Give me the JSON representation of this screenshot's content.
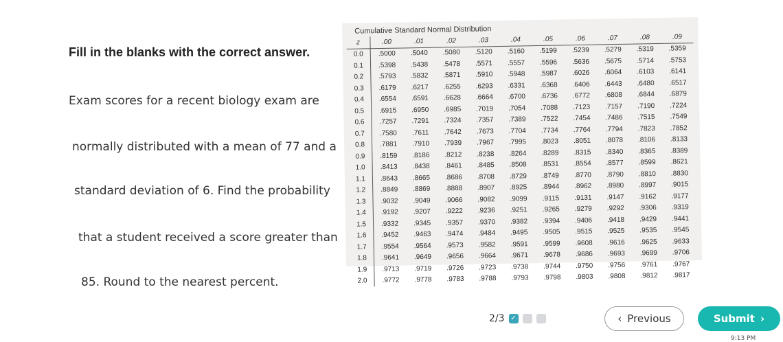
{
  "question": {
    "heading": "Fill in the blanks with the correct answer.",
    "lines": [
      "Exam scores for a recent biology exam are",
      "normally distributed with a mean of 77 and a",
      "standard deviation of 6. Find the probability",
      "that a student received a score greater than",
      "85. Round to the nearest percent."
    ]
  },
  "table": {
    "title": "Cumulative Standard Normal Distribution",
    "z_header": "z",
    "columns": [
      ".00",
      ".01",
      ".02",
      ".03",
      ".04",
      ".05",
      ".06",
      ".07",
      ".08",
      ".09"
    ],
    "rows": [
      {
        "z": "0.0",
        "p": [
          ".5000",
          ".5040",
          ".5080",
          ".5120",
          ".5160",
          ".5199",
          ".5239",
          ".5279",
          ".5319",
          ".5359"
        ]
      },
      {
        "z": "0.1",
        "p": [
          ".5398",
          ".5438",
          ".5478",
          ".5571",
          ".5557",
          ".5596",
          ".5636",
          ".5675",
          ".5714",
          ".5753"
        ]
      },
      {
        "z": "0.2",
        "p": [
          ".5793",
          ".5832",
          ".5871",
          ".5910",
          ".5948",
          ".5987",
          ".6026",
          ".6064",
          ".6103",
          ".6141"
        ]
      },
      {
        "z": "0.3",
        "p": [
          ".6179",
          ".6217",
          ".6255",
          ".6293",
          ".6331",
          ".6368",
          ".6406",
          ".6443",
          ".6480",
          ".6517"
        ]
      },
      {
        "z": "0.4",
        "p": [
          ".6554",
          ".6591",
          ".6628",
          ".6664",
          ".6700",
          ".6736",
          ".6772",
          ".6808",
          ".6844",
          ".6879"
        ]
      },
      {
        "z": "0.5",
        "p": [
          ".6915",
          ".6950",
          ".6985",
          ".7019",
          ".7054",
          ".7088",
          ".7123",
          ".7157",
          ".7190",
          ".7224"
        ]
      },
      {
        "z": "0.6",
        "p": [
          ".7257",
          ".7291",
          ".7324",
          ".7357",
          ".7389",
          ".7522",
          ".7454",
          ".7486",
          ".7515",
          ".7549"
        ]
      },
      {
        "z": "0.7",
        "p": [
          ".7580",
          ".7611",
          ".7642",
          ".7673",
          ".7704",
          ".7734",
          ".7764",
          ".7794",
          ".7823",
          ".7852"
        ]
      },
      {
        "z": "0.8",
        "p": [
          ".7881",
          ".7910",
          ".7939",
          ".7967",
          ".7995",
          ".8023",
          ".8051",
          ".8078",
          ".8106",
          ".8133"
        ]
      },
      {
        "z": "0.9",
        "p": [
          ".8159",
          ".8186",
          ".8212",
          ".8238",
          ".8264",
          ".8289",
          ".8315",
          ".8340",
          ".8365",
          ".8389"
        ]
      },
      {
        "z": "1.0",
        "p": [
          ".8413",
          ".8438",
          ".8461",
          ".8485",
          ".8508",
          ".8531",
          ".8554",
          ".8577",
          ".8599",
          ".8621"
        ]
      },
      {
        "z": "1.1",
        "p": [
          ".8643",
          ".8665",
          ".8686",
          ".8708",
          ".8729",
          ".8749",
          ".8770",
          ".8790",
          ".8810",
          ".8830"
        ]
      },
      {
        "z": "1.2",
        "p": [
          ".8849",
          ".8869",
          ".8888",
          ".8907",
          ".8925",
          ".8944",
          ".8962",
          ".8980",
          ".8997",
          ".9015"
        ]
      },
      {
        "z": "1.3",
        "p": [
          ".9032",
          ".9049",
          ".9066",
          ".9082",
          ".9099",
          ".9115",
          ".9131",
          ".9147",
          ".9162",
          ".9177"
        ]
      },
      {
        "z": "1.4",
        "p": [
          ".9192",
          ".9207",
          ".9222",
          ".9236",
          ".9251",
          ".9265",
          ".9279",
          ".9292",
          ".9306",
          ".9319"
        ]
      },
      {
        "z": "1.5",
        "p": [
          ".9332",
          ".9345",
          ".9357",
          ".9370",
          ".9382",
          ".9394",
          ".9406",
          ".9418",
          ".9429",
          ".9441"
        ]
      },
      {
        "z": "1.6",
        "p": [
          ".9452",
          ".9463",
          ".9474",
          ".9484",
          ".9495",
          ".9505",
          ".9515",
          ".9525",
          ".9535",
          ".9545"
        ]
      },
      {
        "z": "1.7",
        "p": [
          ".9554",
          ".9564",
          ".9573",
          ".9582",
          ".9591",
          ".9599",
          ".9608",
          ".9616",
          ".9625",
          ".9633"
        ]
      },
      {
        "z": "1.8",
        "p": [
          ".9641",
          ".9649",
          ".9656",
          ".9664",
          ".9671",
          ".9678",
          ".9686",
          ".9693",
          ".9699",
          ".9706"
        ]
      },
      {
        "z": "1.9",
        "p": [
          ".9713",
          ".9719",
          ".9726",
          ".9723",
          ".9738",
          ".9744",
          ".9750",
          ".9756",
          ".9761",
          ".9767"
        ]
      },
      {
        "z": "2.0",
        "p": [
          ".9772",
          ".9778",
          ".9783",
          ".9788",
          ".9793",
          ".9798",
          ".9803",
          ".9808",
          ".9812",
          ".9817"
        ]
      }
    ]
  },
  "footer": {
    "page_indicator": "2/3",
    "progress": [
      {
        "state": "done",
        "icon": "check-icon"
      },
      {
        "state": "todo",
        "icon": ""
      },
      {
        "state": "todo",
        "icon": ""
      }
    ],
    "previous_label": "Previous",
    "submit_label": "Submit",
    "clock_text": "9:13 PM"
  },
  "colors": {
    "submit_bg": "#18b7b0",
    "progress_done": "#3aa6b9",
    "progress_todo": "#d6d8dc"
  }
}
